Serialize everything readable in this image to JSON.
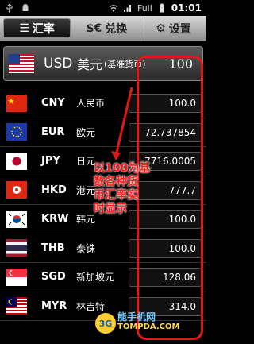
{
  "status_bar": {
    "signal_text": "Full",
    "time": "01:01",
    "icons": [
      "usb-icon",
      "android-icon",
      "wifi-icon",
      "signal-icon",
      "battery-icon"
    ]
  },
  "tabs": [
    {
      "label": "汇率",
      "icon": "list-icon",
      "active": true
    },
    {
      "label": "兑换",
      "icon": "currency-exchange-icon",
      "prefix": "$€",
      "active": false
    },
    {
      "label": "设置",
      "icon": "gear-icon",
      "active": false
    }
  ],
  "base_currency": {
    "code": "USD",
    "name": "美元",
    "note": "(基准货币)",
    "value": "100"
  },
  "rates": [
    {
      "code": "CNY",
      "name": "人民币",
      "value": "100.0"
    },
    {
      "code": "EUR",
      "name": "欧元",
      "value": "72.737854"
    },
    {
      "code": "JPY",
      "name": "日元",
      "value": "7716.0005"
    },
    {
      "code": "HKD",
      "name": "港元",
      "value": "777.7"
    },
    {
      "code": "KRW",
      "name": "韩元",
      "value": "100.0"
    },
    {
      "code": "THB",
      "name": "泰铢",
      "value": "100.0"
    },
    {
      "code": "SGD",
      "name": "新加坡元",
      "value": "128.06"
    },
    {
      "code": "MYR",
      "name": "林吉特",
      "value": "314.0"
    }
  ],
  "annotation": {
    "text_line1": "以100为基",
    "text_line2": "数各种货",
    "text_line3": "币汇率实",
    "text_line4": "时显示",
    "color": "#e0181a"
  },
  "watermark": {
    "line1": "能手机网",
    "line2": "TOMPDA.COM",
    "logo": "3G"
  }
}
